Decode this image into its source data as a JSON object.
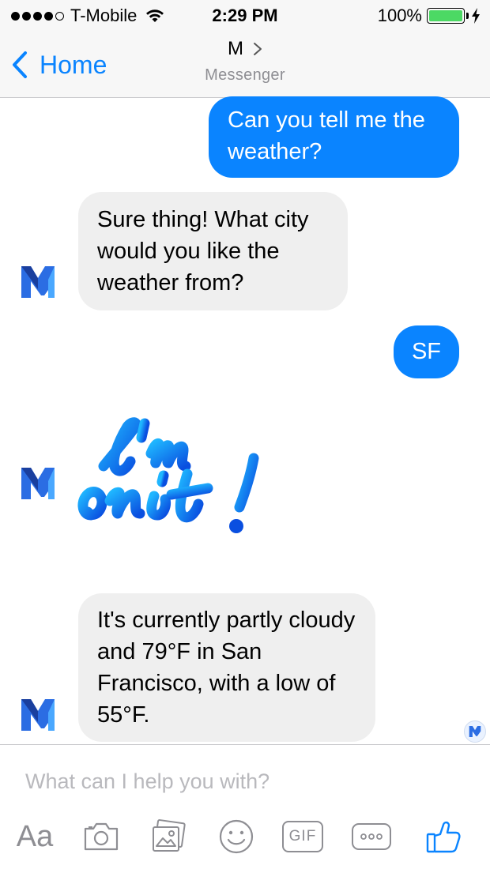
{
  "status_bar": {
    "carrier": "T-Mobile",
    "time": "2:29 PM",
    "battery": "100%"
  },
  "nav": {
    "back_label": "Home",
    "title": "M",
    "subtitle": "Messenger"
  },
  "messages": [
    {
      "direction": "outgoing",
      "text": "Can you tell me the weather?"
    },
    {
      "direction": "incoming",
      "text": "Sure thing! What city would you like the weather from?"
    },
    {
      "direction": "outgoing",
      "text": "SF"
    },
    {
      "direction": "incoming",
      "type": "sticker",
      "text": "I'm on it!"
    },
    {
      "direction": "incoming",
      "text": "It's currently partly cloudy and 79°F in San Francisco, with a low of 55°F."
    }
  ],
  "composer": {
    "placeholder": "What can I help you with?",
    "aa_label": "Aa",
    "gif_label": "GIF"
  },
  "icons": {
    "signal": "signal-dots-icon",
    "wifi": "wifi-icon",
    "battery": "battery-icon",
    "charging": "charging-bolt-icon",
    "back": "chevron-left-icon",
    "title_chevron": "chevron-right-icon",
    "avatar": "m-assistant-logo-icon",
    "camera": "camera-icon",
    "photo": "photo-gallery-icon",
    "emoji": "emoji-icon",
    "gif": "gif-icon",
    "more": "more-icon",
    "like": "thumbs-up-icon"
  },
  "colors": {
    "accent": "#0a84ff",
    "incoming_bubble": "#efefef",
    "battery_fill": "#4cd964"
  }
}
